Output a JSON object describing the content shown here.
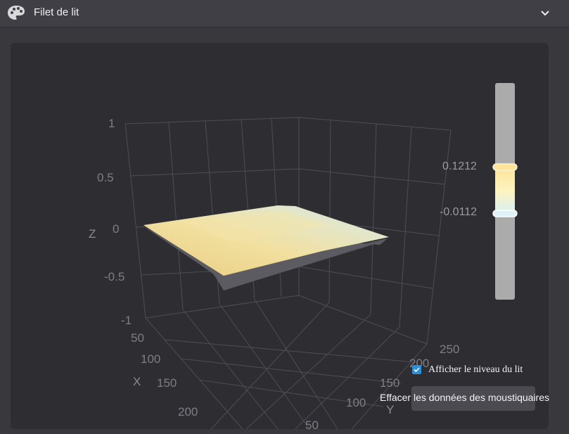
{
  "header": {
    "title": "Filet de lit",
    "icon": "palette-icon",
    "toggle_icon": "chevron-down-icon"
  },
  "plot": {
    "z_axis_label": "Z",
    "x_axis_label": "X",
    "y_axis_label": "Y",
    "z_ticks": [
      "1",
      "0.5",
      "0",
      "-0.5",
      "-1"
    ],
    "x_ticks": [
      "50",
      "100",
      "150",
      "200"
    ],
    "y_ticks": [
      "250",
      "200",
      "150",
      "100",
      "50"
    ]
  },
  "colorbar": {
    "max_label": "0.1212",
    "min_label": "-0.0112",
    "colors": [
      "#fde49a",
      "#fdf3bf",
      "#d8f0f4"
    ]
  },
  "controls": {
    "show_level_label": "Afficher le niveau du lit",
    "show_level_checked": true,
    "clear_button_label": "Effacer les données des moustiquaires"
  },
  "colors": {
    "accent": "#2d8fd8",
    "panel_bg": "#2d2d32",
    "surface_warm": "#f0d890",
    "surface_cool": "#d4e6ea"
  }
}
